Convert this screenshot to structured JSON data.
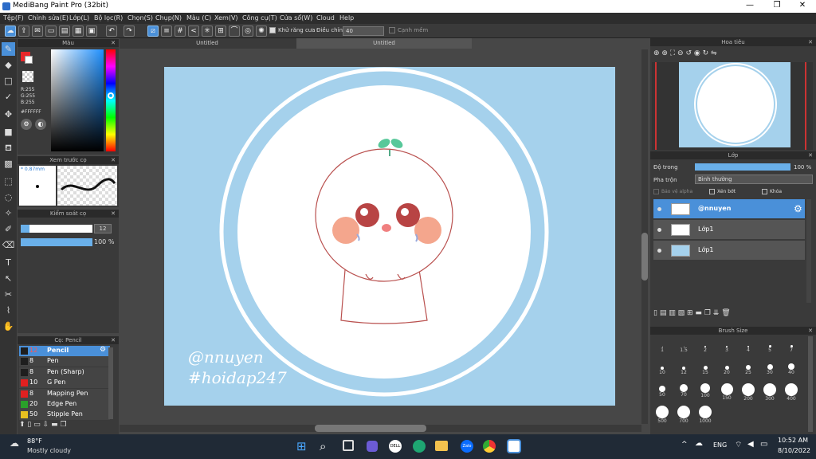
{
  "window": {
    "title": "MediBang Paint Pro (32bit)",
    "minimize": "—",
    "maximize": "❐",
    "close": "✕"
  },
  "menu": [
    "Tệp(F)",
    "Chỉnh sửa(E)",
    "Lớp(L)",
    "Bộ lọc(R)",
    "Chọn(S)",
    "Chụp(N)",
    "Màu (C)",
    "Xem(V)",
    "Công cụ(T)",
    "Cửa sổ(W)",
    "Cloud",
    "Help"
  ],
  "toolbar": {
    "antialias": "Khử răng cưa",
    "adjust_label": "Điều chỉnh",
    "adjust_value": "40",
    "smooth": "Cạnh mềm"
  },
  "panels": {
    "color": "Màu",
    "preview": "Xem trước cọ",
    "brush_control": "Kiểm soát cọ",
    "brushes": "Cọ: Pencil",
    "navigator": "Hoa tiêu",
    "layer": "Lớp",
    "brush_size": "Brush Size"
  },
  "color": {
    "r": "R:255",
    "g": "G:255",
    "b": "B:255",
    "hex": "#FFFFFF",
    "primary": "#e8262a",
    "secondary": "#ffffff"
  },
  "preview": {
    "size": "* 0.87mm"
  },
  "brush_control": {
    "size": "12",
    "opacity": "100 %",
    "size_level": 0.12,
    "opacity_level": 1.0
  },
  "brush_list": [
    {
      "size": "12",
      "name": "Pencil",
      "color": "#1e1e1e",
      "selected": true
    },
    {
      "size": "8",
      "name": "Pen",
      "color": "#1e1e1e"
    },
    {
      "size": "8",
      "name": "Pen (Sharp)",
      "color": "#1e1e1e"
    },
    {
      "size": "10",
      "name": "G Pen",
      "color": "#e02020"
    },
    {
      "size": "8",
      "name": "Mapping Pen",
      "color": "#e02020"
    },
    {
      "size": "20",
      "name": "Edge Pen",
      "color": "#2aa02a"
    },
    {
      "size": "50",
      "name": "Stipple Pen",
      "color": "#e8c020"
    }
  ],
  "tabs": [
    "Untitled",
    "Untitled"
  ],
  "layer_panel": {
    "opacity_label": "Độ trong",
    "opacity_value": "100 %",
    "opacity_level": 1.0,
    "blend_label": "Pha trộn",
    "blend_value": "Bình thường",
    "protect_alpha": "Bảo vệ alpha",
    "clipping": "Xén bớt",
    "lock": "Khóa",
    "layers": [
      {
        "name": "@nnuyen",
        "selected": true
      },
      {
        "name": "Lớp1"
      },
      {
        "name": "Lớp1"
      }
    ]
  },
  "brush_sizes": [
    "1",
    "1.5",
    "2",
    "3",
    "4",
    "5",
    "7",
    "10",
    "12",
    "15",
    "20",
    "25",
    "30",
    "40",
    "50",
    "70",
    "100",
    "150",
    "200",
    "300",
    "400",
    "500",
    "700",
    "1000"
  ],
  "artwork": {
    "signature": "@nnuyen",
    "hashtag": "#hoidap247",
    "bg": "#a5d1ec"
  },
  "taskbar": {
    "temp": "88°F",
    "weather": "Mostly cloudy",
    "lang": "ENG",
    "time": "10:52 AM",
    "date": "8/10/2022"
  }
}
